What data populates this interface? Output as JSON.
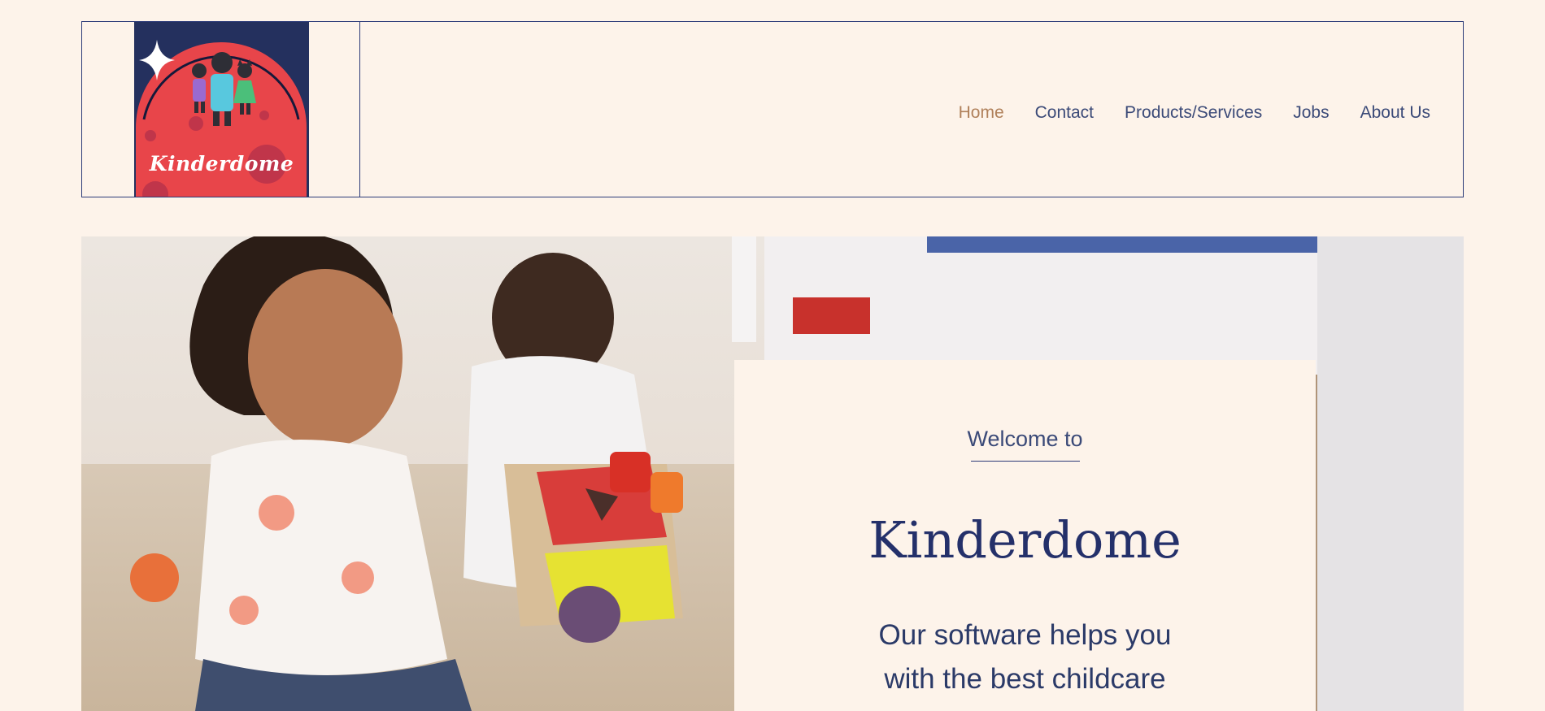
{
  "logo": {
    "text": "Kinderdome",
    "icon": "family-planet-logo"
  },
  "nav": {
    "items": [
      {
        "label": "Home",
        "active": true
      },
      {
        "label": "Contact",
        "active": false
      },
      {
        "label": "Products/Services",
        "active": false
      },
      {
        "label": "Jobs",
        "active": false
      },
      {
        "label": "About Us",
        "active": false
      }
    ]
  },
  "hero": {
    "image": "children-playing-photo",
    "welcome": "Welcome to",
    "title": "Kinderdome",
    "tagline_line1": "Our software helps you",
    "tagline_line2": "with the best childcare"
  },
  "colors": {
    "background": "#fdf3ea",
    "navy": "#24306a",
    "accent": "#b0805a",
    "logo_red": "#e8454a"
  }
}
